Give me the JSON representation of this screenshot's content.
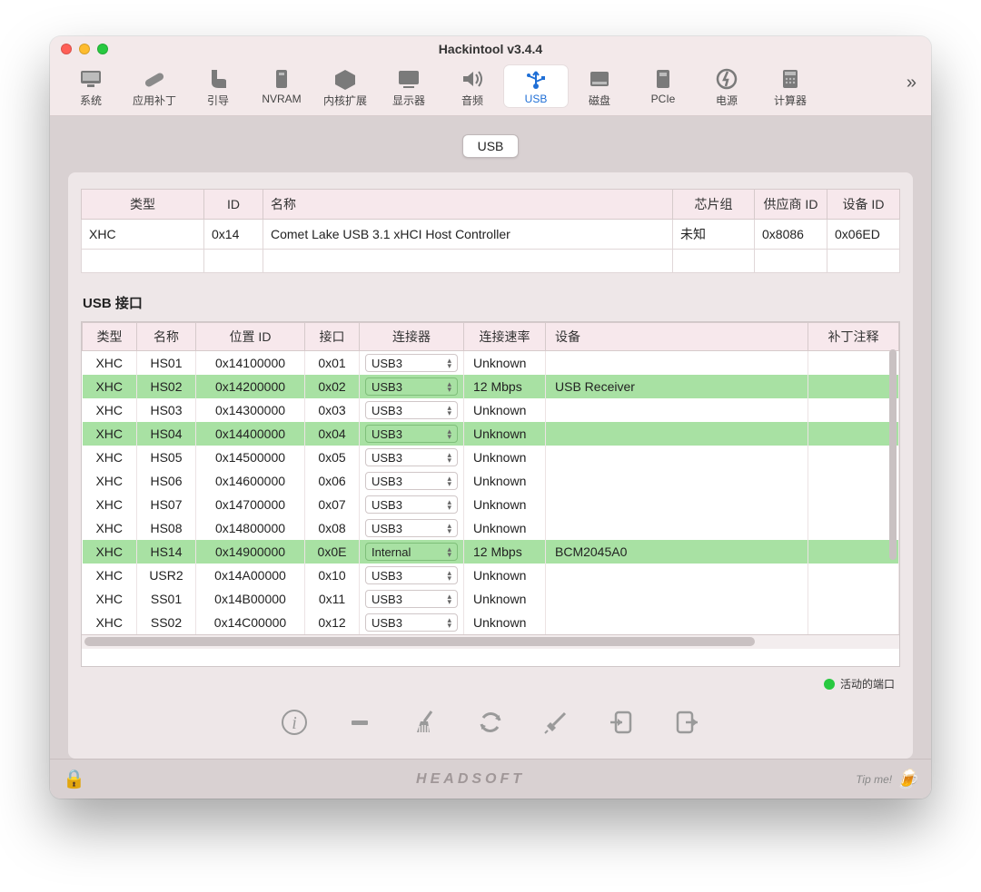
{
  "window": {
    "title": "Hackintool v3.4.4"
  },
  "toolbar": {
    "items": [
      {
        "label": "系统",
        "icon": "monitor-icon"
      },
      {
        "label": "应用补丁",
        "icon": "bandage-icon"
      },
      {
        "label": "引导",
        "icon": "boot-icon"
      },
      {
        "label": "NVRAM",
        "icon": "chip-icon"
      },
      {
        "label": "内核扩展",
        "icon": "puzzle-icon"
      },
      {
        "label": "显示器",
        "icon": "display-icon"
      },
      {
        "label": "音频",
        "icon": "sound-icon"
      },
      {
        "label": "USB",
        "icon": "usb-icon",
        "active": true
      },
      {
        "label": "磁盘",
        "icon": "disk-icon"
      },
      {
        "label": "PCIe",
        "icon": "card-icon"
      },
      {
        "label": "电源",
        "icon": "power-icon"
      },
      {
        "label": "计算器",
        "icon": "calc-icon"
      }
    ]
  },
  "tab": {
    "label": "USB"
  },
  "controllers": {
    "headers": {
      "type": "类型",
      "id": "ID",
      "name": "名称",
      "chipset": "芯片组",
      "vendor": "供应商 ID",
      "device": "设备 ID"
    },
    "rows": [
      {
        "type": "XHC",
        "id": "0x14",
        "name": "Comet Lake USB 3.1 xHCI Host Controller",
        "chipset": "未知",
        "vendor": "0x8086",
        "device": "0x06ED"
      }
    ]
  },
  "section_title": "USB 接口",
  "ports": {
    "headers": {
      "type": "类型",
      "name": "名称",
      "location": "位置 ID",
      "port": "接口",
      "connector": "连接器",
      "speed": "连接速率",
      "device": "设备",
      "comment": "补丁注释"
    },
    "rows": [
      {
        "type": "XHC",
        "name": "HS01",
        "loc": "0x14100000",
        "port": "0x01",
        "conn": "USB3",
        "speed": "Unknown",
        "dev": "",
        "green": false
      },
      {
        "type": "XHC",
        "name": "HS02",
        "loc": "0x14200000",
        "port": "0x02",
        "conn": "USB3",
        "speed": "12 Mbps",
        "dev": "USB Receiver",
        "green": true
      },
      {
        "type": "XHC",
        "name": "HS03",
        "loc": "0x14300000",
        "port": "0x03",
        "conn": "USB3",
        "speed": "Unknown",
        "dev": "",
        "green": false
      },
      {
        "type": "XHC",
        "name": "HS04",
        "loc": "0x14400000",
        "port": "0x04",
        "conn": "USB3",
        "speed": "Unknown",
        "dev": "",
        "green": true
      },
      {
        "type": "XHC",
        "name": "HS05",
        "loc": "0x14500000",
        "port": "0x05",
        "conn": "USB3",
        "speed": "Unknown",
        "dev": "",
        "green": false
      },
      {
        "type": "XHC",
        "name": "HS06",
        "loc": "0x14600000",
        "port": "0x06",
        "conn": "USB3",
        "speed": "Unknown",
        "dev": "",
        "green": false
      },
      {
        "type": "XHC",
        "name": "HS07",
        "loc": "0x14700000",
        "port": "0x07",
        "conn": "USB3",
        "speed": "Unknown",
        "dev": "",
        "green": false
      },
      {
        "type": "XHC",
        "name": "HS08",
        "loc": "0x14800000",
        "port": "0x08",
        "conn": "USB3",
        "speed": "Unknown",
        "dev": "",
        "green": false
      },
      {
        "type": "XHC",
        "name": "HS14",
        "loc": "0x14900000",
        "port": "0x0E",
        "conn": "Internal",
        "speed": "12 Mbps",
        "dev": "BCM2045A0",
        "green": true
      },
      {
        "type": "XHC",
        "name": "USR2",
        "loc": "0x14A00000",
        "port": "0x10",
        "conn": "USB3",
        "speed": "Unknown",
        "dev": "",
        "green": false
      },
      {
        "type": "XHC",
        "name": "SS01",
        "loc": "0x14B00000",
        "port": "0x11",
        "conn": "USB3",
        "speed": "Unknown",
        "dev": "",
        "green": false
      },
      {
        "type": "XHC",
        "name": "SS02",
        "loc": "0x14C00000",
        "port": "0x12",
        "conn": "USB3",
        "speed": "Unknown",
        "dev": "",
        "green": false
      }
    ]
  },
  "legend": {
    "label": "活动的端口"
  },
  "footer": {
    "brand": "HEADSOFT",
    "tip": "Tip me!"
  },
  "action_icons": [
    "info-icon",
    "minus-icon",
    "broom-icon",
    "refresh-icon",
    "inject-icon",
    "import-icon",
    "export-icon"
  ]
}
